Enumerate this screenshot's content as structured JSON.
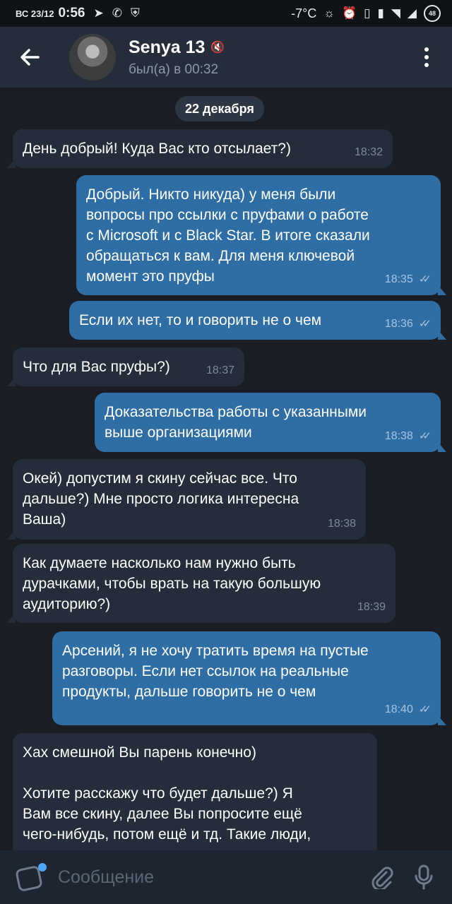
{
  "status_bar": {
    "date": "ВС 23/12",
    "time": "0:56",
    "temperature": "-7°C",
    "battery": "48",
    "left_icons": [
      "telegram-icon",
      "whatsapp-icon",
      "shield-icon"
    ],
    "right_icons": [
      "sun-icon",
      "alarm-icon",
      "phone-icon",
      "vibrate-icon",
      "wifi-icon",
      "signal-icon"
    ]
  },
  "header": {
    "name": "Senya 13",
    "status": "был(а) в 00:32"
  },
  "date_chip": "22 декабря",
  "messages": [
    {
      "text": "День добрый! Куда Вас кто отсылает?)",
      "time": "18:32",
      "out": false
    },
    {
      "text": "Добрый. Никто никуда) у меня были\nвопросы про ссылки с пруфами о работе\nс Microsoft и с Black Star. В итоге сказали\nобращаться к вам. Для меня ключевой\nмомент это пруфы",
      "time": "18:35",
      "out": true
    },
    {
      "text": "Если их нет, то и говорить не о чем",
      "time": "18:36",
      "out": true
    },
    {
      "text": "Что для Вас пруфы?)",
      "time": "18:37",
      "out": false
    },
    {
      "text": "Доказательства работы с указанными\nвыше организациями",
      "time": "18:38",
      "out": true
    },
    {
      "text": "Окей) допустим я скину сейчас все. Что\nдальше?) Мне просто логика интересна\nВаша)",
      "time": "18:38",
      "out": false
    },
    {
      "text": "Как думаете насколько нам нужно быть\nдурачками, чтобы врать на такую большую\nаудиторию?)",
      "time": "18:39",
      "out": false
    },
    {
      "text": "Арсений, я не хочу тратить время на пустые\nразговоры. Если нет ссылок на реальные\nпродукты, дальше говорить не о чем",
      "time": "18:40",
      "out": true
    },
    {
      "text": "Хах смешной Вы парень конечно)\n\nХотите расскажу что будет дальше?) Я\nВам все скину, далее Вы попросите ещё\nчего-нибудь, потом ещё и тд. Такие люди,",
      "time": "",
      "out": false
    }
  ],
  "composer": {
    "placeholder": "Сообщение"
  }
}
